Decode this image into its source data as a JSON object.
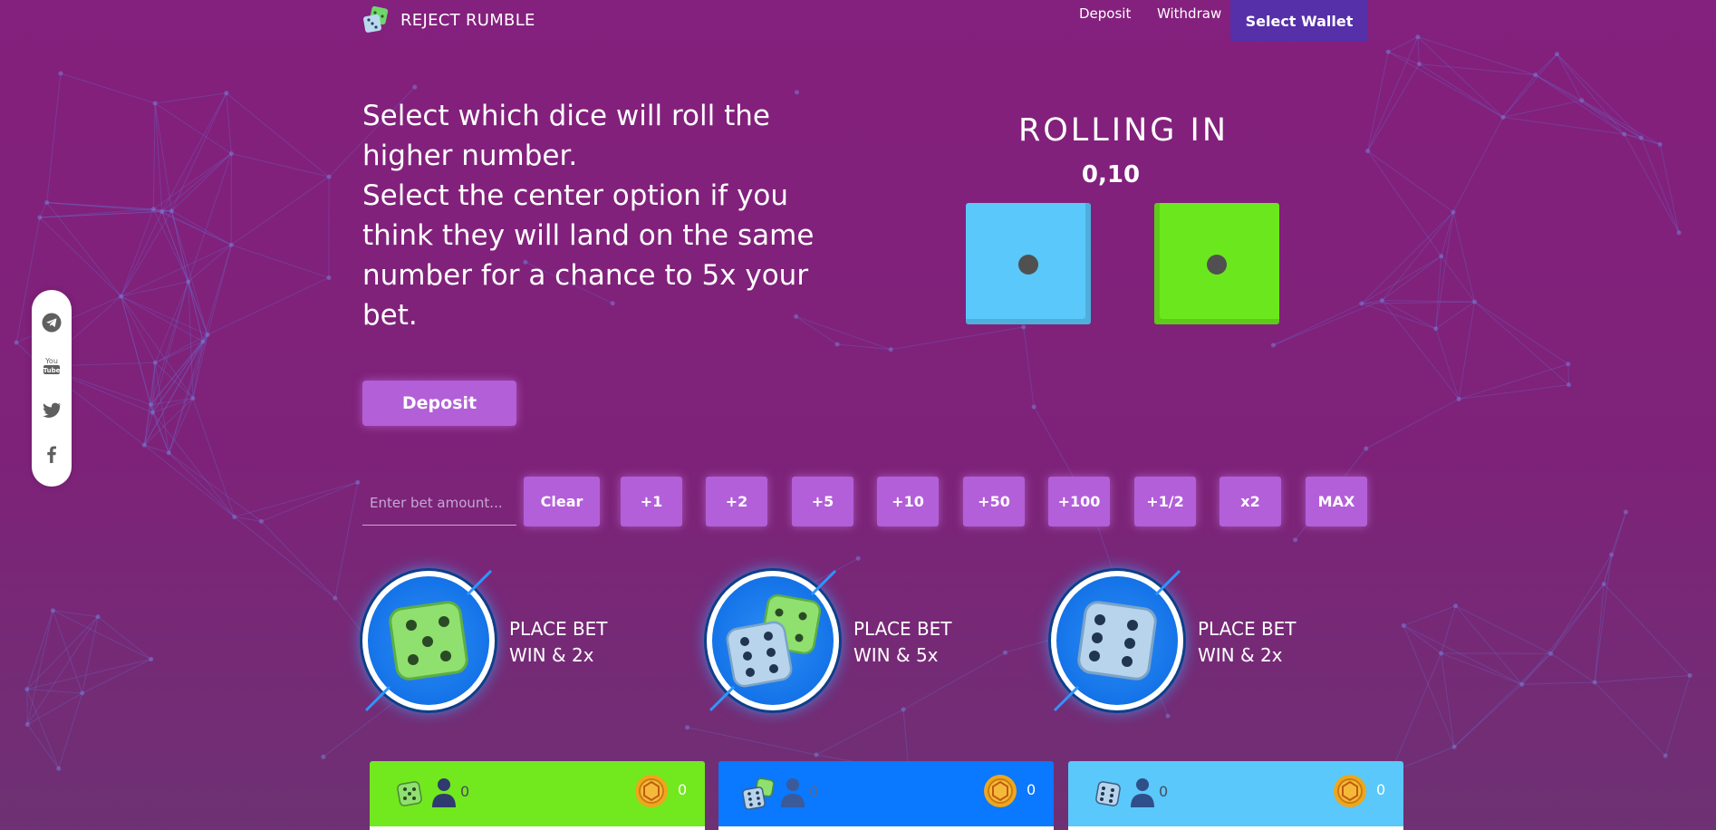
{
  "header": {
    "brand_title": "REJECT RUMBLE",
    "nav": {
      "deposit": "Deposit",
      "withdraw": "Withdraw"
    },
    "wallet_button": "Select Wallet"
  },
  "instructions": {
    "line1": "Select which dice will roll the higher number.",
    "line2": "Select the center option if you think they will land on the same number for a chance to 5x your bet."
  },
  "rolling": {
    "title": "ROLLING IN",
    "countdown": "0,10",
    "dice": [
      {
        "color": "#5ac8fa",
        "value": 1
      },
      {
        "color": "#6be81d",
        "value": 1
      }
    ]
  },
  "deposit_button": "Deposit",
  "bet": {
    "placeholder": "Enter bet amount...",
    "buttons": [
      "Clear",
      "+1",
      "+2",
      "+5",
      "+10",
      "+50",
      "+100",
      "+1/2",
      "x2",
      "MAX"
    ]
  },
  "bet_options": [
    {
      "dice": "green-die-icon",
      "line1": "PLACE BET",
      "line2": "WIN & 2x"
    },
    {
      "dice": "two-dice-icon",
      "line1": "PLACE BET",
      "line2": "WIN & 5x"
    },
    {
      "dice": "blue-die-icon",
      "line1": "PLACE BET",
      "line2": "WIN & 2x"
    }
  ],
  "panels": [
    {
      "color": "#72e81e",
      "players": "0",
      "coins": "0"
    },
    {
      "color": "#0a78ff",
      "players": "0",
      "coins": "0"
    },
    {
      "color": "#5ac8fa",
      "players": "0",
      "coins": "0"
    }
  ],
  "social": [
    "telegram-icon",
    "youtube-icon",
    "twitter-icon",
    "facebook-icon"
  ],
  "colors": {
    "background": "#84207d",
    "accent_button": "#b35fd9",
    "wallet_button": "#5530a8",
    "bet_circle": "#1473e8"
  }
}
